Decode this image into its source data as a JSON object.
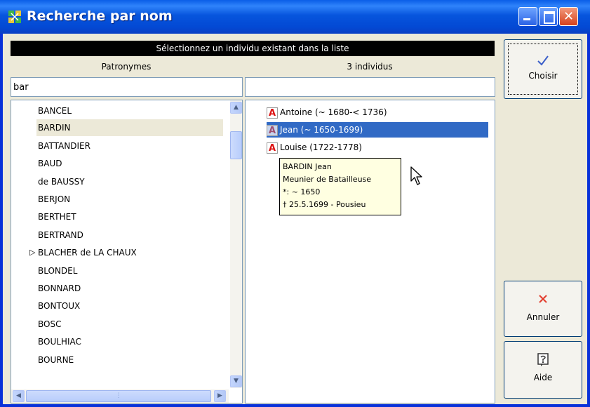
{
  "window": {
    "title": "Recherche par nom",
    "close_glyph": "✕"
  },
  "header": {
    "instruction": "Sélectionnez un individu existant dans la liste"
  },
  "left": {
    "heading": "Patronymes",
    "search_value": "bar",
    "surnames": [
      "BANCEL",
      "BARDIN",
      "BATTANDIER",
      "BAUD",
      "de BAUSSY",
      "BERJON",
      "BERTHET",
      "BERTRAND",
      "BLACHER de LA CHAUX",
      "BLONDEL",
      "BONNARD",
      "BONTOUX",
      "BOSC",
      "BOULHIAC",
      "BOURNE"
    ],
    "selected": "BARDIN",
    "expandable": "BLACHER de LA CHAUX"
  },
  "right": {
    "heading": "3 individus",
    "search_value": "",
    "individuals": [
      "Antoine (~ 1680-< 1736)",
      "Jean (~ 1650-1699)",
      "Louise (1722-1778)"
    ],
    "selected": "Jean (~ 1650-1699)",
    "icon_letter": "A"
  },
  "tooltip": {
    "lines": [
      "BARDIN Jean",
      "Meunier de Batailleuse",
      "*: ~ 1650",
      "† 25.5.1699 - Pousieu"
    ]
  },
  "buttons": {
    "choisir": "Choisir",
    "annuler": "Annuler",
    "aide": "Aide"
  },
  "icons": {
    "app": "app-tree-icon",
    "check": "check-icon",
    "cross": "cross-icon",
    "help": "help-icon"
  },
  "colors": {
    "titlebar": "#0a5ee8",
    "selection": "#316ac5",
    "tooltip_bg": "#ffffe1",
    "face": "#ece9d8"
  }
}
